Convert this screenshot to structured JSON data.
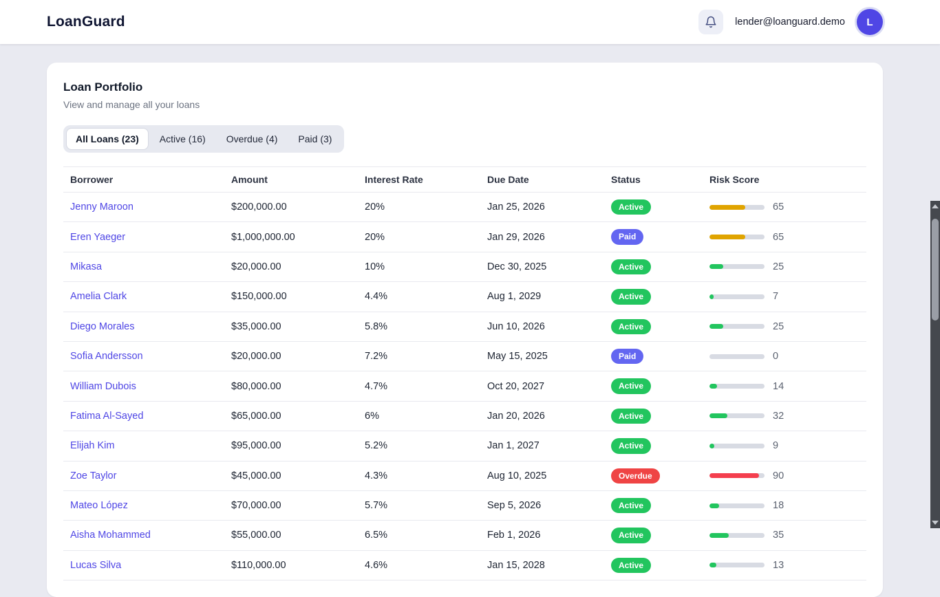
{
  "brand": "LoanGuard",
  "header": {
    "email": "lender@loanguard.demo",
    "avatar_initial": "L"
  },
  "portfolio": {
    "title": "Loan Portfolio",
    "subtitle": "View and manage all your loans"
  },
  "tabs": [
    {
      "label": "All Loans (23)",
      "active": true
    },
    {
      "label": "Active (16)",
      "active": false
    },
    {
      "label": "Overdue (4)",
      "active": false
    },
    {
      "label": "Paid (3)",
      "active": false
    }
  ],
  "table": {
    "columns": [
      "Borrower",
      "Amount",
      "Interest Rate",
      "Due Date",
      "Status",
      "Risk Score"
    ],
    "rows": [
      {
        "borrower": "Jenny Maroon",
        "amount": "$200,000.00",
        "rate": "20%",
        "due": "Jan 25, 2026",
        "status": "Active",
        "risk": 65
      },
      {
        "borrower": "Eren Yaeger",
        "amount": "$1,000,000.00",
        "rate": "20%",
        "due": "Jan 29, 2026",
        "status": "Paid",
        "risk": 65
      },
      {
        "borrower": "Mikasa",
        "amount": "$20,000.00",
        "rate": "10%",
        "due": "Dec 30, 2025",
        "status": "Active",
        "risk": 25
      },
      {
        "borrower": "Amelia Clark",
        "amount": "$150,000.00",
        "rate": "4.4%",
        "due": "Aug 1, 2029",
        "status": "Active",
        "risk": 7
      },
      {
        "borrower": "Diego Morales",
        "amount": "$35,000.00",
        "rate": "5.8%",
        "due": "Jun 10, 2026",
        "status": "Active",
        "risk": 25
      },
      {
        "borrower": "Sofia Andersson",
        "amount": "$20,000.00",
        "rate": "7.2%",
        "due": "May 15, 2025",
        "status": "Paid",
        "risk": 0
      },
      {
        "borrower": "William Dubois",
        "amount": "$80,000.00",
        "rate": "4.7%",
        "due": "Oct 20, 2027",
        "status": "Active",
        "risk": 14
      },
      {
        "borrower": "Fatima Al-Sayed",
        "amount": "$65,000.00",
        "rate": "6%",
        "due": "Jan 20, 2026",
        "status": "Active",
        "risk": 32
      },
      {
        "borrower": "Elijah Kim",
        "amount": "$95,000.00",
        "rate": "5.2%",
        "due": "Jan 1, 2027",
        "status": "Active",
        "risk": 9
      },
      {
        "borrower": "Zoe Taylor",
        "amount": "$45,000.00",
        "rate": "4.3%",
        "due": "Aug 10, 2025",
        "status": "Overdue",
        "risk": 90
      },
      {
        "borrower": "Mateo López",
        "amount": "$70,000.00",
        "rate": "5.7%",
        "due": "Sep 5, 2026",
        "status": "Active",
        "risk": 18
      },
      {
        "borrower": "Aisha Mohammed",
        "amount": "$55,000.00",
        "rate": "6.5%",
        "due": "Feb 1, 2026",
        "status": "Active",
        "risk": 35
      },
      {
        "borrower": "Lucas Silva",
        "amount": "$110,000.00",
        "rate": "4.6%",
        "due": "Jan 15, 2028",
        "status": "Active",
        "risk": 13
      }
    ]
  },
  "status_colors": {
    "Active": "#22c55e",
    "Paid": "#6366f1",
    "Overdue": "#ef4444"
  },
  "risk_colors": {
    "low": "#22c55e",
    "medium": "#e0a400",
    "high": "#f43f4e"
  },
  "risk_max": 100
}
